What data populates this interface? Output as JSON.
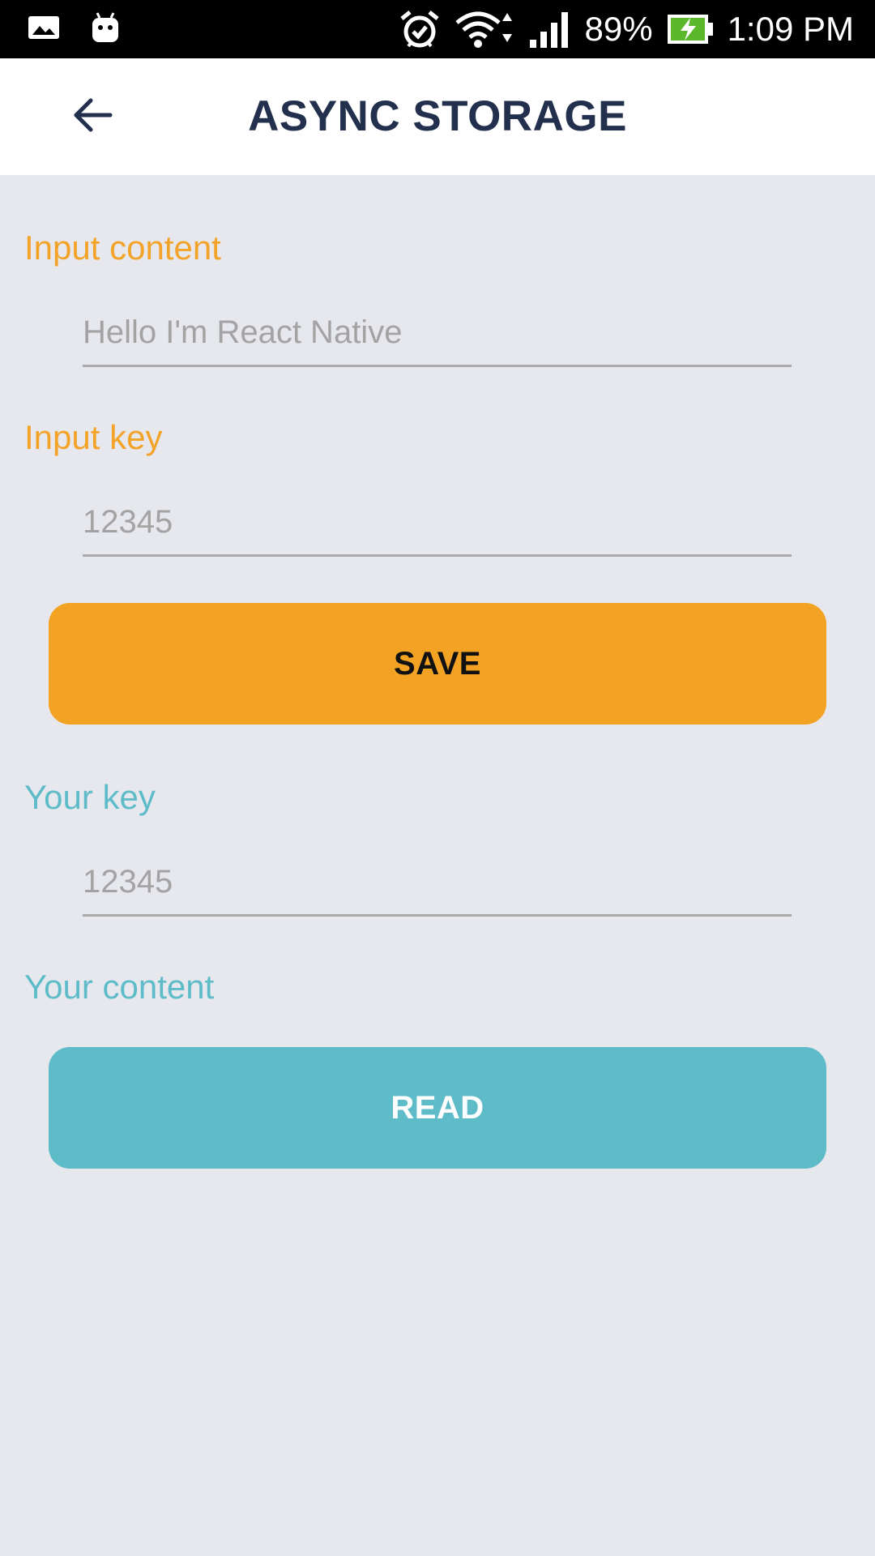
{
  "status_bar": {
    "battery": "89%",
    "time": "1:09 PM",
    "icons": [
      "image-icon",
      "android-icon",
      "alarm-icon",
      "wifi-icon",
      "signal-icon",
      "battery-charging-icon"
    ]
  },
  "header": {
    "title": "ASYNC STORAGE",
    "back_icon": "arrow-left-icon"
  },
  "save_section": {
    "content_label": "Input content",
    "content_placeholder": "Hello I'm React Native",
    "key_label": "Input key",
    "key_placeholder": "12345",
    "save_label": "SAVE"
  },
  "read_section": {
    "key_label": "Your key",
    "key_placeholder": "12345",
    "content_label": "Your content",
    "read_label": "READ"
  },
  "colors": {
    "accent_orange": "#f2a324",
    "accent_teal": "#5ebcc9",
    "title_navy": "#22304d",
    "background": "#e7e8ee"
  }
}
